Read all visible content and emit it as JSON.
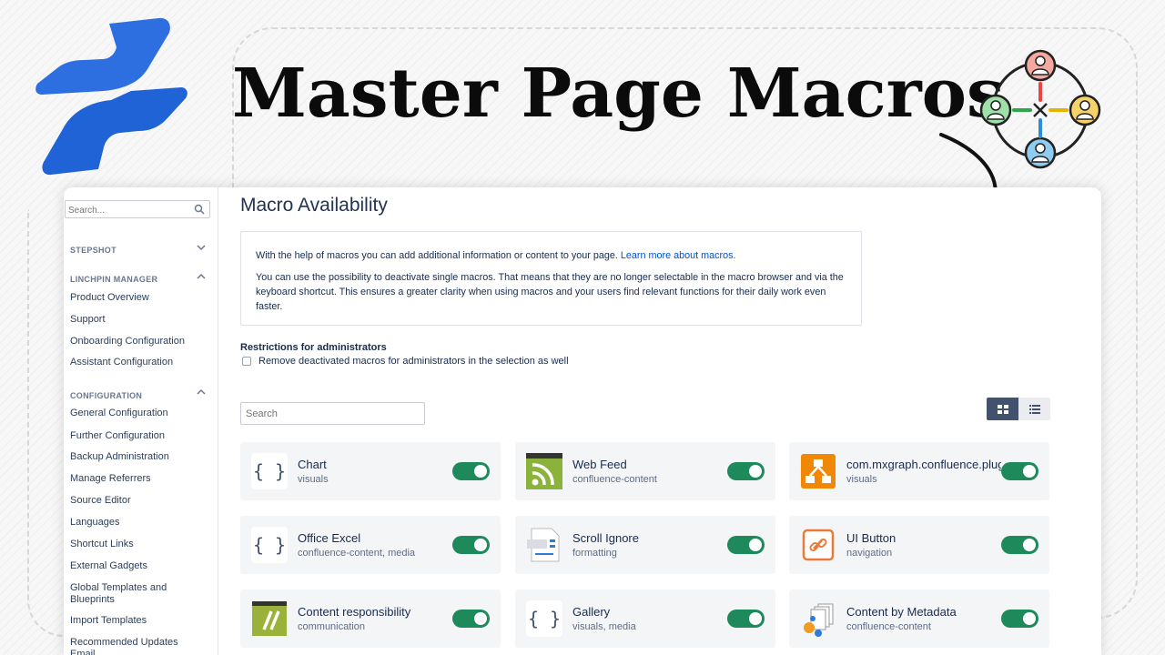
{
  "headline": "Master Page Macros",
  "sidebar": {
    "search_placeholder": "Search...",
    "sections": [
      {
        "title": "STEPSHOT",
        "items": []
      },
      {
        "title": "LINCHPIN MANAGER",
        "items": [
          "Product Overview",
          "Support",
          "Onboarding Configuration",
          "Assistant Configuration"
        ]
      },
      {
        "title": "CONFIGURATION",
        "items": [
          "General Configuration",
          "Further Configuration",
          "Backup Administration",
          "Manage Referrers",
          "Source Editor",
          "Languages",
          "Shortcut Links",
          "External Gadgets",
          "Global Templates and Blueprints",
          "Import Templates",
          "Recommended Updates Email"
        ]
      }
    ]
  },
  "main": {
    "title": "Macro Availability",
    "info_p1": "With the help of macros you can add additional information or content to your page. ",
    "info_link": "Learn more about macros.",
    "info_p2": "You can use the possibility to deactivate single macros. That means that they are no longer selectable in the macro browser and via the keyboard shortcut. This ensures a greater clarity when using macros and your users find relevant functions for their daily work even faster.",
    "restrictions_title": "Restrictions for administrators",
    "restrictions_option": "Remove deactivated macros for administrators in the selection as well",
    "search_placeholder": "Search",
    "macros": [
      {
        "name": "Chart",
        "category": "visuals",
        "icon": "braces-icon",
        "enabled": true
      },
      {
        "name": "Web Feed",
        "category": "confluence-content",
        "icon": "rss-feed-icon",
        "enabled": true
      },
      {
        "name": "com.mxgraph.confluence.plugins",
        "category": "visuals",
        "icon": "drawio-diagram-icon",
        "enabled": true
      },
      {
        "name": "Office Excel",
        "category": "confluence-content, media",
        "icon": "braces-icon",
        "enabled": true
      },
      {
        "name": "Scroll Ignore",
        "category": "formatting",
        "icon": "ignore-document-icon",
        "enabled": true
      },
      {
        "name": "UI Button",
        "category": "navigation",
        "icon": "link-button-icon",
        "enabled": true
      },
      {
        "name": "Content responsibility",
        "category": "communication",
        "icon": "slash-marks-icon",
        "enabled": true
      },
      {
        "name": "Gallery",
        "category": "visuals, media",
        "icon": "braces-icon",
        "enabled": true
      },
      {
        "name": "Content by Metadata",
        "category": "confluence-content",
        "icon": "metadata-pages-icon",
        "enabled": true
      }
    ],
    "toggle_color": "#1e8a5b"
  }
}
